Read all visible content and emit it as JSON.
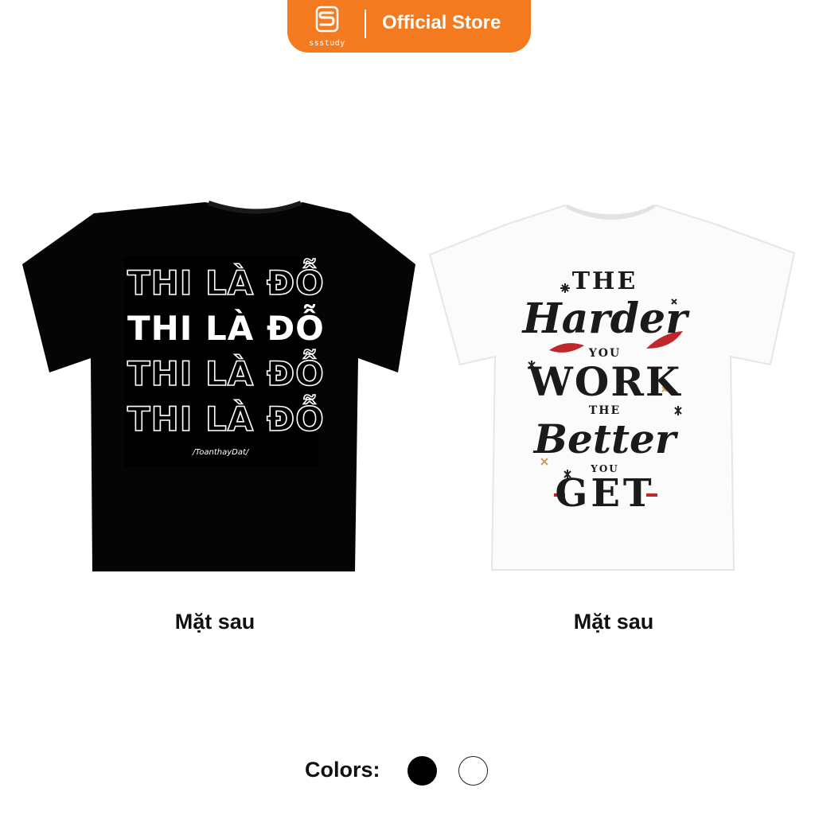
{
  "header": {
    "logo_text": "ssstudy",
    "store_label": "Official Store",
    "accent_color": "#f47a20"
  },
  "products": [
    {
      "shirt_color": "black",
      "print_lines": [
        "THI LÀ ĐỖ",
        "THI LÀ ĐỖ",
        "THI LÀ ĐỖ",
        "THI LÀ ĐỖ"
      ],
      "print_signature": "/ToanthayDat/",
      "caption": "Mặt sau"
    },
    {
      "shirt_color": "white",
      "print_words": [
        "THE",
        "Harder",
        "YOU",
        "WORK",
        "THE",
        "Better",
        "YOU",
        "GET"
      ],
      "caption": "Mặt sau"
    }
  ],
  "colors": {
    "label": "Colors:",
    "options": [
      "black",
      "white"
    ]
  }
}
